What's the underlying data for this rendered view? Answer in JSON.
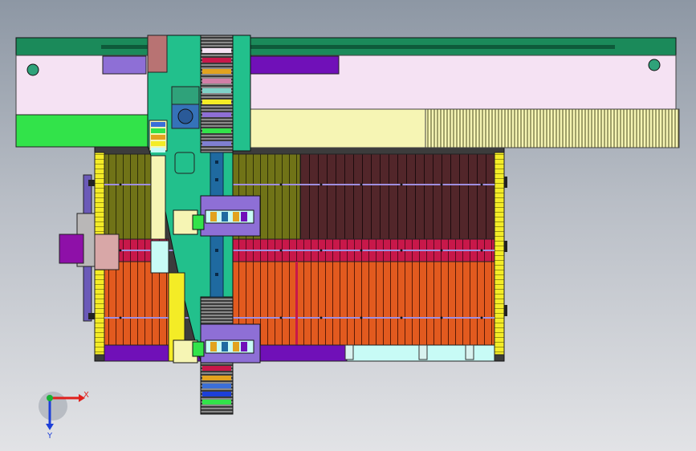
{
  "viewport": {
    "background_top": "#8d97a4",
    "background_bottom": "#e2e3e6"
  },
  "triad": {
    "x_label": "X",
    "y_label": "Y",
    "x_color": "#e0201c",
    "y_color": "#1d3fd8",
    "z_color": "#19b234"
  },
  "colors": {
    "frame_green": "#1b8a5a",
    "beam_pink": "#f5e2f3",
    "beam_yellow": "#f6f5b4",
    "carriage_teal": "#22c08c",
    "panel_olive": "#707317",
    "panel_maroon": "#52262a",
    "panel_orange": "#e25a1f",
    "stripe_red": "#c8184a",
    "block_purple": "#8e6fd6",
    "base_purple": "#7010b8",
    "side_yellow": "#f4ec26",
    "cyan_strip": "#c8fbf6",
    "lime": "#32e34a"
  }
}
